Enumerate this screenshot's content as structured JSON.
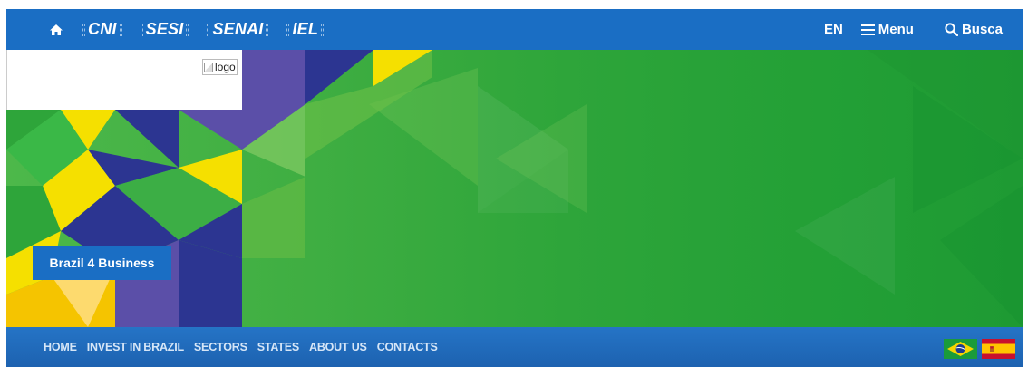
{
  "topbar": {
    "brands": [
      "CNI",
      "SESI",
      "SENAI",
      "IEL"
    ],
    "lang_label": "EN",
    "menu_label": "Menu",
    "search_label": "Busca",
    "bg_color": "#1a6ec4"
  },
  "hero": {
    "logo_alt": "logo",
    "cta_label": "Brazil 4 Business"
  },
  "nav": {
    "items": [
      "HOME",
      "INVEST IN BRAZIL",
      "SECTORS",
      "STATES",
      "ABOUT US",
      "CONTACTS"
    ]
  },
  "colors": {
    "primary": "#1a6ec4",
    "green": "#2ea53a",
    "yellow": "#f5e000",
    "navy": "#2c3591"
  }
}
